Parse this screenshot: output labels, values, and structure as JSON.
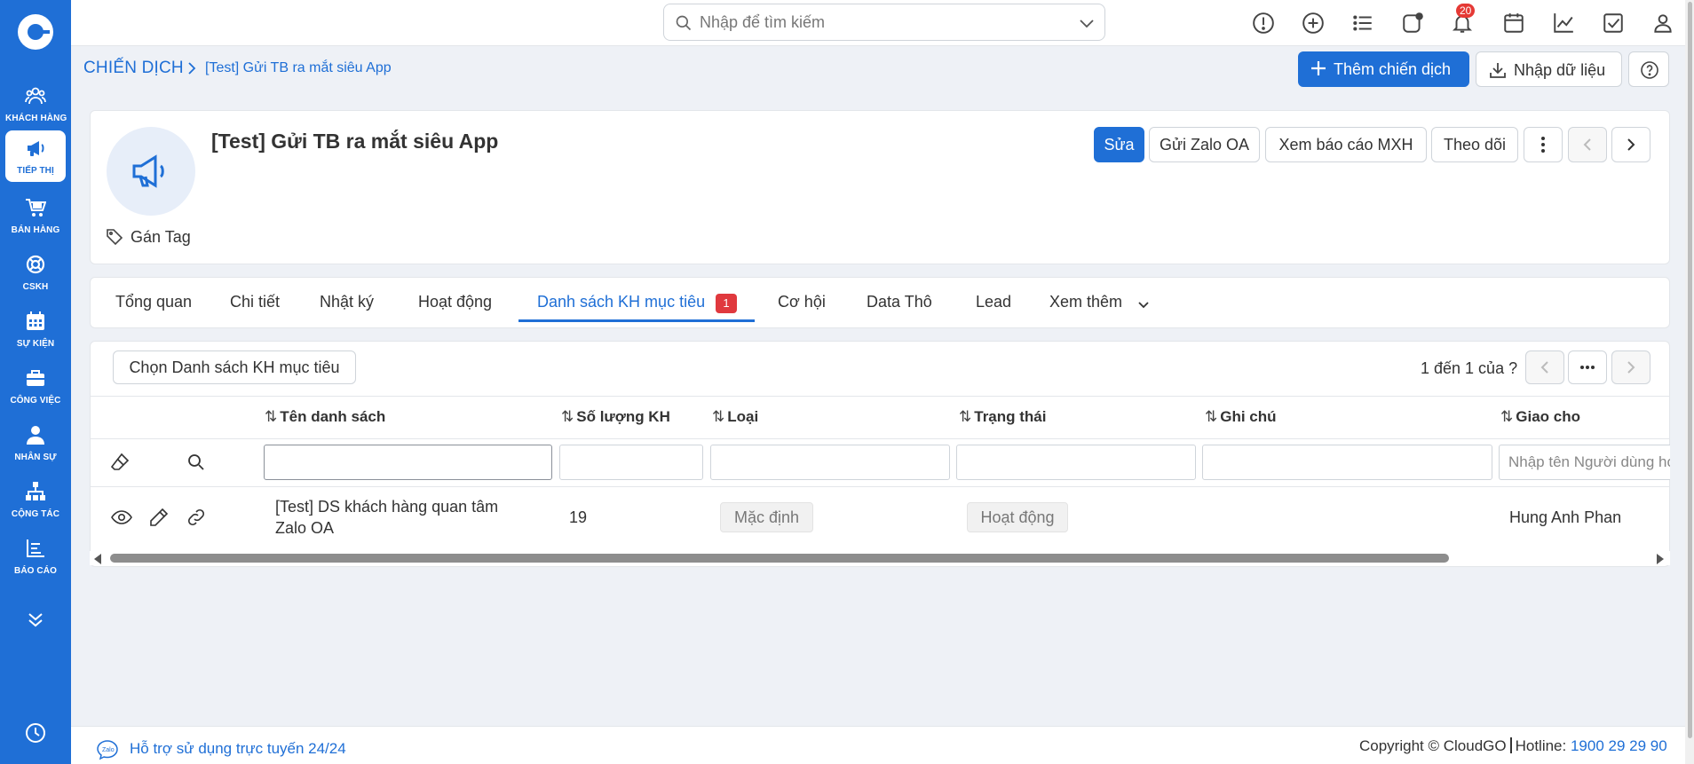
{
  "sidebar": {
    "items": [
      {
        "label": "KHÁCH HÀNG",
        "icon": "customers-icon"
      },
      {
        "label": "TIẾP THỊ",
        "icon": "megaphone-icon"
      },
      {
        "label": "BÁN HÀNG",
        "icon": "cart-icon"
      },
      {
        "label": "CSKH",
        "icon": "lifebuoy-icon"
      },
      {
        "label": "SỰ KIỆN",
        "icon": "calendar-icon"
      },
      {
        "label": "CÔNG VIỆC",
        "icon": "briefcase-icon"
      },
      {
        "label": "NHÂN SỰ",
        "icon": "person-icon"
      },
      {
        "label": "CỘNG TÁC",
        "icon": "org-chart-icon"
      },
      {
        "label": "BÁO CÁO",
        "icon": "report-icon"
      }
    ],
    "active_index": 1
  },
  "search": {
    "placeholder": "Nhập để tìm kiếm"
  },
  "topbar": {
    "notification_count": "20"
  },
  "breadcrumb": {
    "root": "CHIẾN DỊCH",
    "current": "[Test] Gửi TB ra mắt siêu App"
  },
  "actions": {
    "add_label": "Thêm chiến dịch",
    "import_label": "Nhập dữ liệu"
  },
  "campaign": {
    "title": "[Test] Gửi TB ra mắt siêu App",
    "tag_label": "Gán Tag",
    "buttons": {
      "edit": "Sửa",
      "zalo": "Gửi Zalo OA",
      "report": "Xem báo cáo MXH",
      "follow": "Theo dõi"
    }
  },
  "tabs": [
    {
      "label": "Tổng quan"
    },
    {
      "label": "Chi tiết"
    },
    {
      "label": "Nhật ký"
    },
    {
      "label": "Hoạt động"
    },
    {
      "label": "Danh sách KH mục tiêu",
      "badge": "1",
      "active": true
    },
    {
      "label": "Cơ hội"
    },
    {
      "label": "Data Thô"
    },
    {
      "label": "Lead"
    },
    {
      "label": "Xem thêm"
    }
  ],
  "list": {
    "choose_label": "Chọn Danh sách KH mục tiêu",
    "pager_text": "1 đến 1 của ?",
    "sort_glyph": "⇅",
    "columns": [
      "Tên danh sách",
      "Số lượng KH",
      "Loại",
      "Trạng thái",
      "Ghi chú",
      "Giao cho"
    ],
    "assign_placeholder": "Nhập tên Người dùng hoặc Nhóm",
    "rows": [
      {
        "name_line1": "[Test] DS khách hàng quan tâm",
        "name_line2": "Zalo OA",
        "count": "19",
        "type": "Mặc định",
        "status": "Hoạt động",
        "note": "",
        "assigned": "Hung Anh Phan"
      }
    ]
  },
  "footer": {
    "support": "Hỗ trợ sử dụng trực tuyến 24/24",
    "copyright": "Copyright © CloudGO",
    "hotline_label": "Hotline:",
    "hotline": "1900 29 29 90"
  },
  "colors": {
    "brand": "#1f6fd6",
    "badge": "#e0393e"
  }
}
